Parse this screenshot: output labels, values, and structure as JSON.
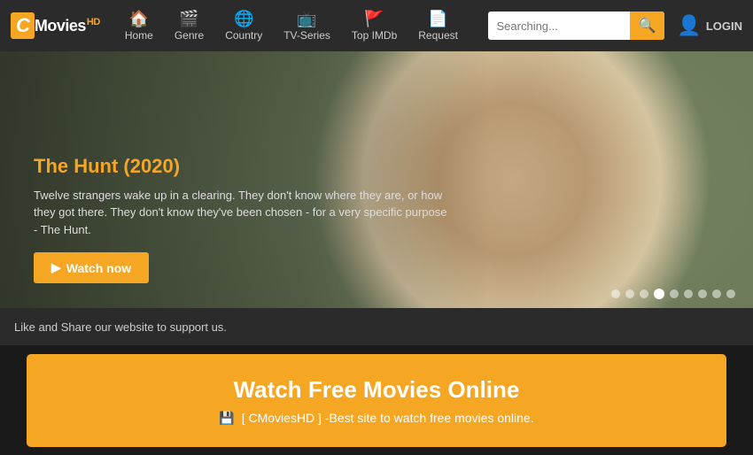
{
  "navbar": {
    "logo_c": "C",
    "logo_movies": "Movies",
    "logo_hd": "HD",
    "nav_items": [
      {
        "id": "home",
        "label": "Home",
        "icon": "🏠"
      },
      {
        "id": "genre",
        "label": "Genre",
        "icon": "🎬"
      },
      {
        "id": "country",
        "label": "Country",
        "icon": "🌐"
      },
      {
        "id": "tv-series",
        "label": "TV-Series",
        "icon": "📺"
      },
      {
        "id": "top-imdb",
        "label": "Top IMDb",
        "icon": "🚩"
      },
      {
        "id": "request",
        "label": "Request",
        "icon": "📄"
      }
    ],
    "search_placeholder": "Searching...",
    "login_label": "LOGIN"
  },
  "hero": {
    "movie_title": "The Hunt (2020)",
    "movie_desc": "Twelve strangers wake up in a clearing. They don't know where they are, or how they got there. They don't know they've been chosen - for a very specific purpose - The Hunt.",
    "watch_now_label": "Watch now",
    "dots_count": 9,
    "active_dot": 3
  },
  "support_bar": {
    "text": "Like and Share our website to support us."
  },
  "promo": {
    "title": "Watch Free Movies Online",
    "subtitle": "[ CMoviesHD ] -Best site to watch free movies online."
  }
}
